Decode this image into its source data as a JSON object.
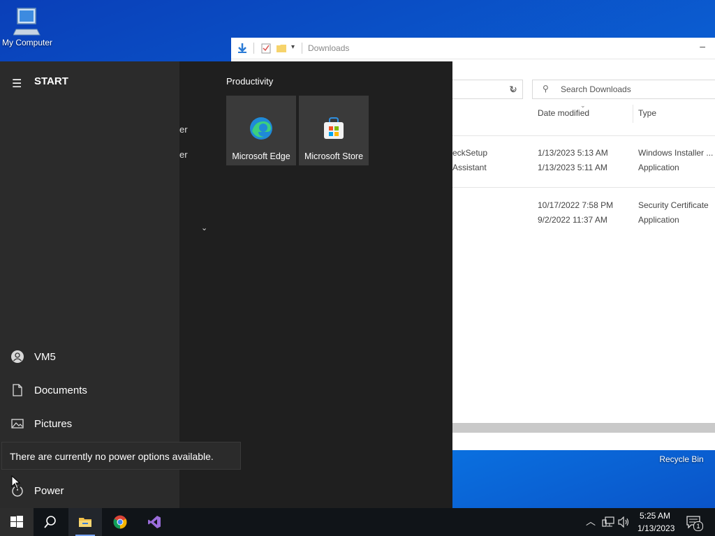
{
  "desktop": {
    "my_computer": "My Computer",
    "recycle_bin": "Recycle Bin"
  },
  "explorer": {
    "title": "Downloads",
    "search_placeholder": "Search Downloads",
    "columns": {
      "date_modified": "Date modified",
      "type": "Type"
    },
    "rows": [
      {
        "name_fragment": "eckSetup",
        "date": "1/13/2023 5:13 AM",
        "type": "Windows Installer ..."
      },
      {
        "name_fragment": "Assistant",
        "date": "1/13/2023 5:11 AM",
        "type": "Application"
      },
      {
        "name_fragment": "",
        "date": "10/17/2022 7:58 PM",
        "type": "Security Certificate"
      },
      {
        "name_fragment": "",
        "date": "9/2/2022 11:37 AM",
        "type": "Application"
      }
    ]
  },
  "start_menu": {
    "title": "START",
    "group_label": "Productivity",
    "tiles": [
      {
        "label": "Microsoft Edge",
        "icon": "edge-icon"
      },
      {
        "label": "Microsoft Store",
        "icon": "store-icon"
      }
    ],
    "app_list_peek": [
      "er",
      "er"
    ],
    "sidebar": {
      "user": "VM5",
      "documents": "Documents",
      "pictures": "Pictures",
      "power": "Power"
    },
    "tooltip": "There are currently no power options available."
  },
  "taskbar": {
    "apps": [
      "windows-start-icon",
      "search-icon",
      "file-explorer-icon",
      "chrome-icon",
      "visual-studio-icon"
    ],
    "clock": {
      "time": "5:25 AM",
      "date": "1/13/2023"
    },
    "notification_count": "1"
  }
}
